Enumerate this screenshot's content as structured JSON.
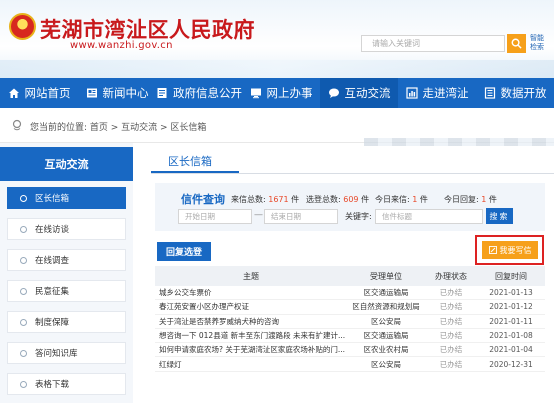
{
  "header": {
    "title": "芜湖市湾沚区人民政府",
    "url": "www.wanzhi.gov.cn",
    "search_placeholder": "请输入关键词",
    "smart_search": "智能检索"
  },
  "nav": [
    {
      "label": "网站首页",
      "icon": "home-icon"
    },
    {
      "label": "新闻中心",
      "icon": "news-icon"
    },
    {
      "label": "政府信息公开",
      "icon": "document-icon"
    },
    {
      "label": "网上办事",
      "icon": "monitor-icon"
    },
    {
      "label": "互动交流",
      "icon": "chat-icon"
    },
    {
      "label": "走进湾沚",
      "icon": "chart-icon"
    },
    {
      "label": "数据开放",
      "icon": "data-icon"
    }
  ],
  "breadcrumb": "您当前的位置: 首页 > 互动交流 > 区长信箱",
  "sidebar": {
    "title": "互动交流",
    "items": [
      {
        "label": "区长信箱"
      },
      {
        "label": "在线访谈"
      },
      {
        "label": "在线调查"
      },
      {
        "label": "民意征集"
      },
      {
        "label": "制度保障"
      },
      {
        "label": "答问知识库"
      },
      {
        "label": "表格下载"
      }
    ]
  },
  "main": {
    "tab": "区长信箱",
    "stats": {
      "title": "信件查询",
      "received_label": "来信总数:",
      "received_value": "1671",
      "received_unit": "件",
      "selected_label": "选登总数:",
      "selected_value": "609",
      "selected_unit": "件",
      "today_received_label": "今日来信:",
      "today_received_value": "1",
      "today_received_unit": "件",
      "today_reply_label": "今日回复:",
      "today_reply_value": "1",
      "today_reply_unit": "件"
    },
    "filters": {
      "start_date": "开始日期",
      "end_date": "结束日期",
      "keyword_label": "关键字:",
      "keyword_placeholder": "信件标题",
      "search_button": "搜索"
    },
    "reply_button": "回复选登",
    "write_button": "我要写信",
    "table": {
      "headers": [
        "主题",
        "受理单位",
        "办理状态",
        "回复时间"
      ],
      "rows": [
        [
          "城乡公交车票价",
          "区交通运输局",
          "已办结",
          "2021-01-13"
        ],
        [
          "春江苑安置小区办理产权证",
          "区自然资源和规划局",
          "已办结",
          "2021-01-12"
        ],
        [
          "关于湾沚是否禁养罗威纳犬种的咨询",
          "区公安局",
          "已办结",
          "2021-01-11"
        ],
        [
          "想咨询一下 012县道 新丰至东门渡路段 未来有扩建计...",
          "区交通运输局",
          "已办结",
          "2021-01-08"
        ],
        [
          "如何申请家庭农场? 关于芜湖湾沚区家庭农场补贴的门...",
          "区农业农村局",
          "已办结",
          "2021-01-04"
        ],
        [
          "红绿灯",
          "区公安局",
          "已办结",
          "2020-12-31"
        ]
      ]
    }
  }
}
